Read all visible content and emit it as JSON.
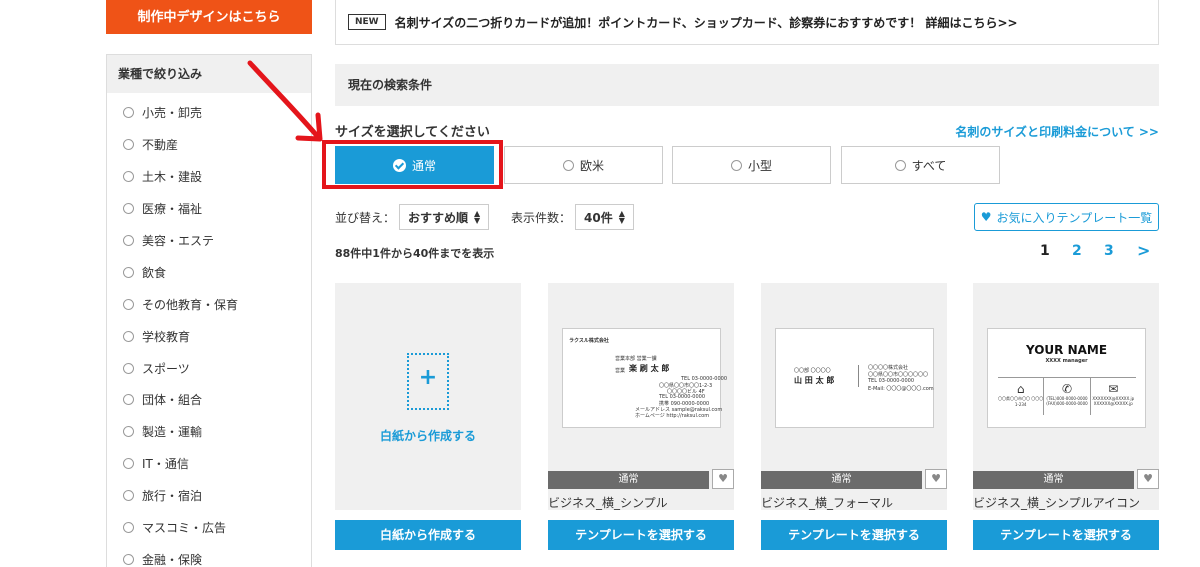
{
  "sidebar": {
    "design_button": "制作中デザインはこちら",
    "filter_title": "業種で絞り込み",
    "items": [
      "小売・卸売",
      "不動産",
      "土木・建設",
      "医療・福祉",
      "美容・エステ",
      "飲食",
      "その他教育・保育",
      "学校教育",
      "スポーツ",
      "団体・組合",
      "製造・運輸",
      "IT・通信",
      "旅行・宿泊",
      "マスコミ・広告",
      "金融・保険"
    ]
  },
  "notice": {
    "badge": "NEW",
    "text": "名刺サイズの二つ折りカードが追加！ポイントカード、ショップカード、診察券におすすめです！ 詳細はこちら>>"
  },
  "conditions_label": "現在の検索条件",
  "size": {
    "title": "サイズを選択してください",
    "link": "名刺のサイズと印刷料金について >>",
    "options": [
      "通常",
      "欧米",
      "小型",
      "すべて"
    ],
    "selected": "通常"
  },
  "sort": {
    "label": "並び替え：",
    "value": "おすすめ順",
    "count_label": "表示件数：",
    "count_value": "40件"
  },
  "favorites_button": "お気に入りテンプレート一覧",
  "result_text": "88件中1件から40件までを表示",
  "pager": [
    "1",
    "2",
    "3",
    ">"
  ],
  "cards": [
    {
      "label": "白紙から作成する",
      "button": "白紙から作成する"
    },
    {
      "tag": "通常",
      "name": "ビジネス_横_シンプル",
      "button": "テンプレートを選択する",
      "preview": {
        "company": "ラクスル株式会社",
        "dept": "営業本部 営業一課",
        "title": "営業",
        "name": "楽 刷 太 郎",
        "lines": [
          "TEL 03-0000-0000",
          "〇〇県〇〇市〇〇1-2-3",
          "〇〇〇〇ビル 4F",
          "TEL 03-0000-0000",
          "携帯 090-0000-0000",
          "メールアドレス sample@raksul.com",
          "ホームページ http://raksul.com"
        ]
      }
    },
    {
      "tag": "通常",
      "name": "ビジネス_横_フォーマル",
      "button": "テンプレートを選択する",
      "preview": {
        "prefix": "〇〇部 〇〇〇〇",
        "name": "山 田 太 郎",
        "lines": [
          "〇〇〇〇株式会社",
          "〇〇県〇〇市〇〇〇〇〇〇",
          "TEL 03-0000-0000",
          "E-Mail: 〇〇〇@〇〇〇.com"
        ]
      }
    },
    {
      "tag": "通常",
      "name": "ビジネス_横_シンプルアイコン",
      "button": "テンプレートを選択する",
      "preview": {
        "headline": "YOUR NAME",
        "subline": "XXXX manager",
        "cols": [
          "〇〇県〇〇市〇〇 〇〇〇1-234",
          "(TEL)000-0000-0000 (FAX)000-0000-0000",
          "XXXXXXX@XXXXX.jp XXXXXX@XXXXX.jp"
        ]
      }
    }
  ],
  "colors": {
    "accent": "#1a9bd7",
    "brand_orange": "#ef5317",
    "highlight_red": "#e4151b"
  },
  "icons": [
    "check-icon",
    "heart-icon",
    "home-icon",
    "phone-icon",
    "mail-icon",
    "red-arrow-annotation"
  ]
}
